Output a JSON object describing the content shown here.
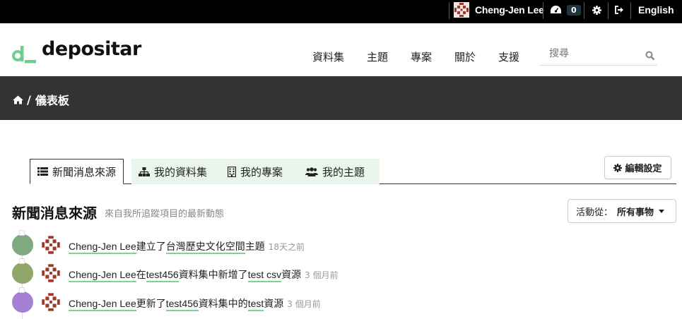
{
  "account_bar": {
    "user_name": "Cheng-Jen Lee",
    "dashboard_count": "0",
    "language": "English"
  },
  "masthead": {
    "site_name": "depositar",
    "nav": [
      "資料集",
      "主題",
      "專案",
      "關於",
      "支援"
    ],
    "search_placeholder": "搜尋"
  },
  "breadcrumb": {
    "current": "儀表板"
  },
  "tabs": [
    {
      "label": "新聞消息來源",
      "icon": "list-icon",
      "active": true
    },
    {
      "label": "我的資料集",
      "icon": "sitemap-icon",
      "active": false
    },
    {
      "label": "我的專案",
      "icon": "building-icon",
      "active": false
    },
    {
      "label": "我的主題",
      "icon": "users-icon",
      "active": false
    }
  ],
  "edit_settings_label": "編輯設定",
  "news_feed": {
    "title": "新聞消息來源",
    "subtitle": "來自我所追蹤項目的最新動態",
    "filter_label": "活動從：",
    "filter_value": "所有事物"
  },
  "activities": [
    {
      "bubble_color": "#7faa7f",
      "actor": "Cheng-Jen Lee",
      "verb1": "建立了",
      "object": "台灣歷史文化空間",
      "verb2": "主題",
      "object2": "",
      "tail": "",
      "time": "18天之前"
    },
    {
      "bubble_color": "#8fa86a",
      "actor": "Cheng-Jen Lee",
      "verb1": "在",
      "object": "test456",
      "verb2": "資料集中新增了",
      "object2": "test csv",
      "tail": "資源",
      "time": "3 個月前"
    },
    {
      "bubble_color": "#a57fd1",
      "actor": "Cheng-Jen Lee",
      "verb1": "更新了",
      "object": "test456",
      "verb2": "資料集中的",
      "object2": "test",
      "tail": "資源",
      "time": "3 個月前"
    }
  ]
}
